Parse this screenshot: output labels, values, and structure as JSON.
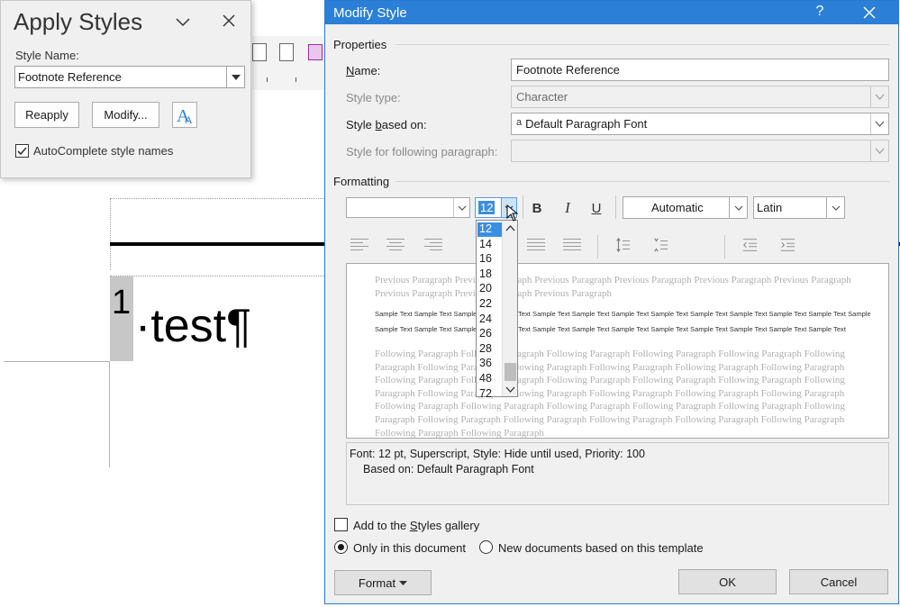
{
  "apply_styles": {
    "title": "Apply Styles",
    "style_name_label": "Style Name:",
    "style_name_value": "Footnote Reference",
    "reapply_label": "Reapply",
    "modify_label": "Modify...",
    "autocomplete_label": "AutoComplete style names",
    "autocomplete_checked": true
  },
  "document": {
    "footnote_number": "1",
    "footnote_text": "·test¶"
  },
  "dialog": {
    "title": "Modify Style",
    "help_label": "?",
    "properties_label": "Properties",
    "name_label": "Name:",
    "name_value": "Footnote Reference",
    "style_type_label": "Style type:",
    "style_type_value": "Character",
    "based_on_label": "Style based on:",
    "based_on_value": "Default Paragraph Font",
    "based_on_glyph": "a",
    "following_label": "Style for following paragraph:",
    "following_value": "",
    "formatting_label": "Formatting",
    "font_value": "",
    "size_value": "12",
    "bold_label": "B",
    "italic_label": "I",
    "underline_label": "U",
    "color_value": "Automatic",
    "script_value": "Latin",
    "size_options": [
      "12",
      "14",
      "16",
      "18",
      "20",
      "22",
      "24",
      "26",
      "28",
      "36",
      "48",
      "72"
    ],
    "selected_size": "12",
    "preview": {
      "previous": "Previous Paragraph Previous Paragraph Previous Paragraph Previous Paragraph Previous Paragraph Previous Paragraph Previous Paragraph Previous Paragraph Previous Paragraph",
      "sample_1": "Sample Text Sample Text Sample Text Sample Text Sample Text Sample Text Sample Text Sample Text Sample Text Sample Text Sample Text Sample Text Sample Text Sample Text",
      "sample_2": "Sample Text Sample Text Sample Text Sample Text Sample Text Sample Text Sample Text Sample Text Sample Text Sample Text Sample Text Sample Text",
      "following": "Following Paragraph Following Paragraph Following Paragraph Following Paragraph Following Paragraph Following Paragraph Following Paragraph Following Paragraph Following Paragraph Following Paragraph Following Paragraph Following Paragraph Following Paragraph Following Paragraph Following Paragraph Following Paragraph Following Paragraph Following Paragraph Following Paragraph Following Paragraph Following Paragraph Following Paragraph Following Paragraph Following Paragraph Following Paragraph Following Paragraph Following Paragraph Following Paragraph Following Paragraph Following Paragraph Following Paragraph Following Paragraph Following Paragraph Following Paragraph Following Paragraph"
    },
    "description_line1": "Font: 12 pt, Superscript, Style: Hide until used, Priority: 100",
    "description_line2": "Based on: Default Paragraph Font",
    "add_gallery_pre": "Add to the ",
    "add_gallery_u": "S",
    "add_gallery_post": "tyles gallery",
    "only_doc_label": "Only in this document",
    "new_docs_label": "New documents based on this template",
    "format_label": "Format",
    "ok_label": "OK",
    "cancel_label": "Cancel"
  },
  "colors": {
    "titlebar": "#2b7fd6",
    "selection": "#3b8fe0"
  }
}
